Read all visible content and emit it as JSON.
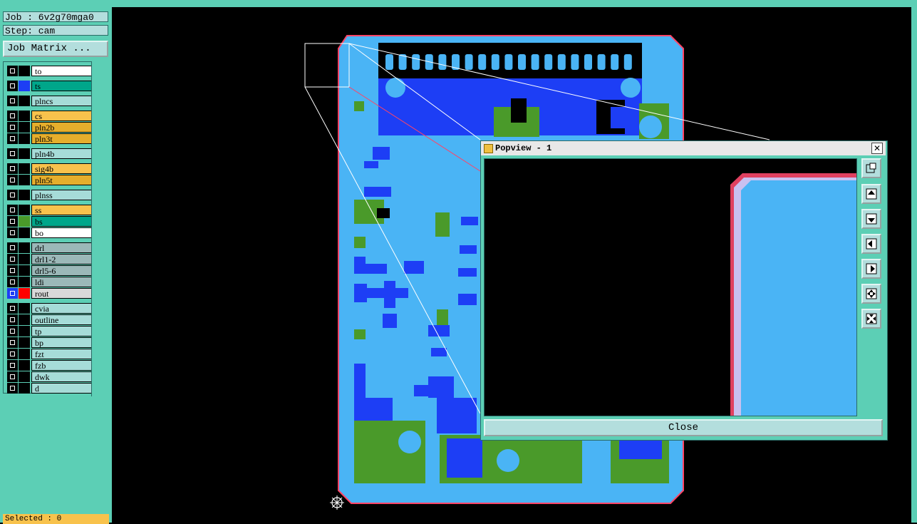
{
  "job_label": "Job : 6v2g70mga0",
  "step_label": "Step: cam",
  "matrix_button": "Job Matrix ...",
  "layers": [
    {
      "name": "to",
      "color": "#ffffff",
      "swatch": "#000000"
    },
    {
      "name": "ts",
      "color": "#00a68a",
      "swatch": "#1d3ef5"
    },
    {
      "name": "plncs",
      "color": "#a6dcd8",
      "swatch": "#000000"
    },
    {
      "name": "cs",
      "color": "#f8c24c",
      "swatch": "#000000"
    },
    {
      "name": "pln2b",
      "color": "#e5ae2c",
      "swatch": "#000000"
    },
    {
      "name": "pln3t",
      "color": "#e5ae2c",
      "swatch": "#000000"
    },
    {
      "name": "pln4b",
      "color": "#a6dcd8",
      "swatch": "#000000"
    },
    {
      "name": "sig4b",
      "color": "#f8c24c",
      "swatch": "#000000"
    },
    {
      "name": "pln5t",
      "color": "#e5ae2c",
      "swatch": "#000000"
    },
    {
      "name": "plnss",
      "color": "#a6dcd8",
      "swatch": "#000000"
    },
    {
      "name": "ss",
      "color": "#f8c24c",
      "swatch": "#000000"
    },
    {
      "name": "bs",
      "color": "#00a68a",
      "swatch": "#4a9a2a"
    },
    {
      "name": "bo",
      "color": "#ffffff",
      "swatch": "#000000"
    },
    {
      "name": "drl",
      "color": "#9bb8b8",
      "swatch": "#000000"
    },
    {
      "name": "drl1-2",
      "color": "#9bb8b8",
      "swatch": "#000000"
    },
    {
      "name": "drl5-6",
      "color": "#9bb8b8",
      "swatch": "#000000"
    },
    {
      "name": "ldi",
      "color": "#9bb8b8",
      "swatch": "#000000"
    },
    {
      "name": "rout",
      "color": "#d9d9d9",
      "swatch": "#ff0000"
    },
    {
      "name": "cvia",
      "color": "#a6dcd8",
      "swatch": "#000000"
    },
    {
      "name": "outline",
      "color": "#a6dcd8",
      "swatch": "#000000"
    },
    {
      "name": "tp",
      "color": "#a6dcd8",
      "swatch": "#000000"
    },
    {
      "name": "bp",
      "color": "#a6dcd8",
      "swatch": "#000000"
    },
    {
      "name": "fzt",
      "color": "#a6dcd8",
      "swatch": "#000000"
    },
    {
      "name": "fzb",
      "color": "#a6dcd8",
      "swatch": "#000000"
    },
    {
      "name": "dwk",
      "color": "#a6dcd8",
      "swatch": "#000000"
    },
    {
      "name": "d",
      "color": "#a6dcd8",
      "swatch": "#000000"
    }
  ],
  "selected_label": "Selected : 0",
  "popview": {
    "title": "Popview - 1",
    "close_label": "Close",
    "toolbar": [
      "zoom-fit-icon",
      "move-up-icon",
      "move-down-icon",
      "move-left-icon",
      "move-right-icon",
      "zoom-in-icon",
      "zoom-out-icon"
    ]
  },
  "colors": {
    "panel": "#5ccfb5",
    "board_fill": "#4ab4f5",
    "board_outline": "#ff4466",
    "top_copper": "#1d3ef5",
    "bottom_copper": "#4a9a2a"
  }
}
